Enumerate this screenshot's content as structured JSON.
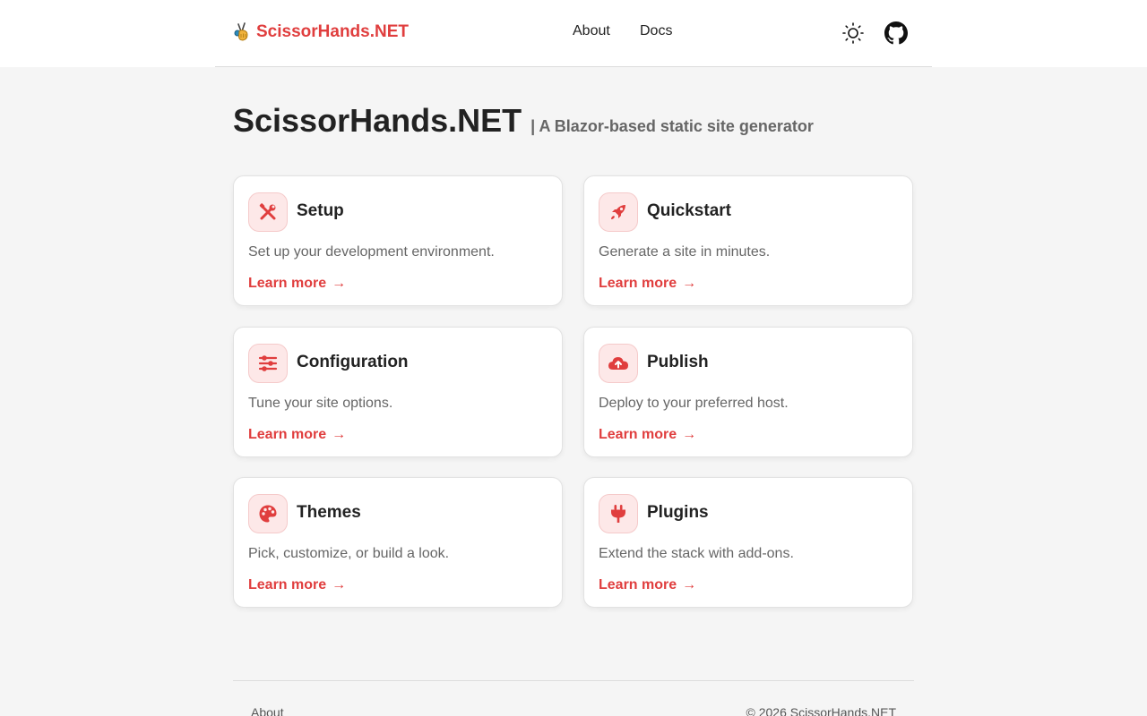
{
  "header": {
    "brand": "ScissorHands.NET",
    "logo_icon": "scissors-hand-logo-icon",
    "nav": [
      {
        "label": "About"
      },
      {
        "label": "Docs"
      }
    ],
    "theme_icon": "sun-icon",
    "github_icon": "github-icon"
  },
  "hero": {
    "title": "ScissorHands.NET",
    "subtitle": "| A Blazor-based static site generator"
  },
  "cards": [
    {
      "title": "Setup",
      "description": "Set up your development environment.",
      "link": "Learn more",
      "arrow": "→",
      "icon": "tools-icon"
    },
    {
      "title": "Quickstart",
      "description": "Generate a site in minutes.",
      "link": "Learn more",
      "arrow": "→",
      "icon": "rocket-icon"
    },
    {
      "title": "Configuration",
      "description": "Tune your site options.",
      "link": "Learn more",
      "arrow": "→",
      "icon": "sliders-icon"
    },
    {
      "title": "Publish",
      "description": "Deploy to your preferred host.",
      "link": "Learn more",
      "arrow": "→",
      "icon": "cloud-upload-icon"
    },
    {
      "title": "Themes",
      "description": "Pick, customize, or build a look.",
      "link": "Learn more",
      "arrow": "→",
      "icon": "palette-icon"
    },
    {
      "title": "Plugins",
      "description": "Extend the stack with add-ons.",
      "link": "Learn more",
      "arrow": "→",
      "icon": "plug-icon"
    }
  ],
  "footer": {
    "about": "About",
    "copyright": "© 2026 ScissorHands.NET"
  },
  "colors": {
    "accent": "#e03e3e",
    "icon_bg": "#fde8e8",
    "page_bg": "#f5f5f5"
  }
}
